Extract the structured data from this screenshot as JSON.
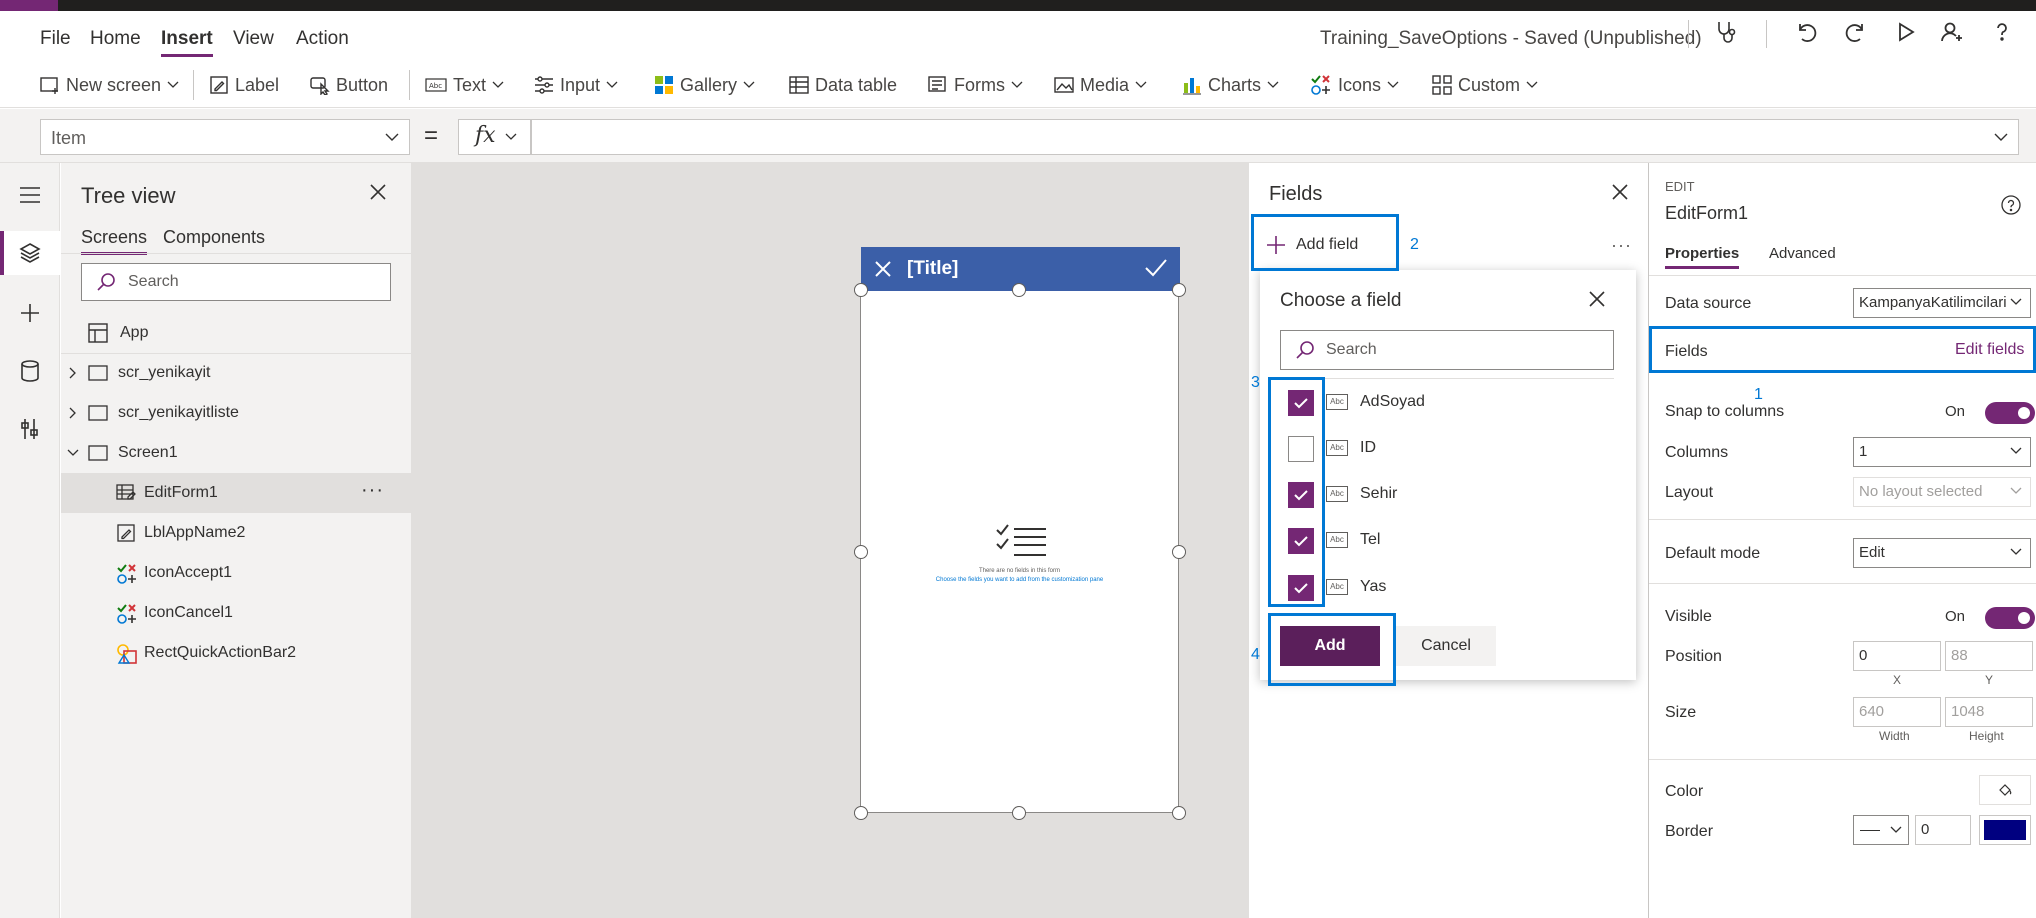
{
  "menu": {
    "file": "File",
    "home": "Home",
    "insert": "Insert",
    "view": "View",
    "action": "Action"
  },
  "app_title": "Training_SaveOptions - Saved (Unpublished)",
  "ribbon": {
    "new_screen": "New screen",
    "label": "Label",
    "button": "Button",
    "text": "Text",
    "input": "Input",
    "gallery": "Gallery",
    "data_table": "Data table",
    "forms": "Forms",
    "media": "Media",
    "charts": "Charts",
    "icons": "Icons",
    "custom": "Custom"
  },
  "formula": {
    "property": "Item",
    "equals": "=",
    "fx": "fx"
  },
  "tree": {
    "title": "Tree view",
    "tabs": {
      "screens": "Screens",
      "components": "Components"
    },
    "search_placeholder": "Search",
    "app": "App",
    "items": [
      "scr_yenikayit",
      "scr_yenikayitliste",
      "Screen1",
      "EditForm1",
      "LblAppName2",
      "IconAccept1",
      "IconCancel1",
      "RectQuickActionBar2"
    ]
  },
  "phone": {
    "title": "[Title]",
    "empty_line1": "There are no fields in this form",
    "empty_line2": "Choose the fields you want to add from the customization pane"
  },
  "fields_panel": {
    "title": "Fields",
    "add_field": "Add field",
    "more": "···"
  },
  "chooser": {
    "title": "Choose a field",
    "search_placeholder": "Search",
    "abc": "Abc",
    "fields": [
      {
        "name": "AdSoyad",
        "checked": true
      },
      {
        "name": "ID",
        "checked": false
      },
      {
        "name": "Sehir",
        "checked": true
      },
      {
        "name": "Tel",
        "checked": true
      },
      {
        "name": "Yas",
        "checked": true
      }
    ],
    "add": "Add",
    "cancel": "Cancel"
  },
  "annotations": {
    "n1": "1",
    "n2": "2",
    "n3": "3",
    "n4": "4"
  },
  "props": {
    "edit_label": "EDIT",
    "control_name": "EditForm1",
    "tabs": {
      "properties": "Properties",
      "advanced": "Advanced"
    },
    "data_source_label": "Data source",
    "data_source_value": "KampanyaKatilimcilari",
    "fields_label": "Fields",
    "edit_fields": "Edit fields",
    "snap_label": "Snap to columns",
    "snap_value": "On",
    "columns_label": "Columns",
    "columns_value": "1",
    "layout_label": "Layout",
    "layout_value": "No layout selected",
    "default_mode_label": "Default mode",
    "default_mode_value": "Edit",
    "visible_label": "Visible",
    "visible_value": "On",
    "position_label": "Position",
    "pos_x": "0",
    "pos_y": "88",
    "x_label": "X",
    "y_label": "Y",
    "size_label": "Size",
    "width": "640",
    "height": "1048",
    "width_label": "Width",
    "height_label": "Height",
    "color_label": "Color",
    "border_label": "Border",
    "border_value": "0",
    "border_color": "#000080"
  },
  "colors": {
    "accent": "#742774",
    "header": "#3b5fa8",
    "highlight": "#0078d4"
  }
}
